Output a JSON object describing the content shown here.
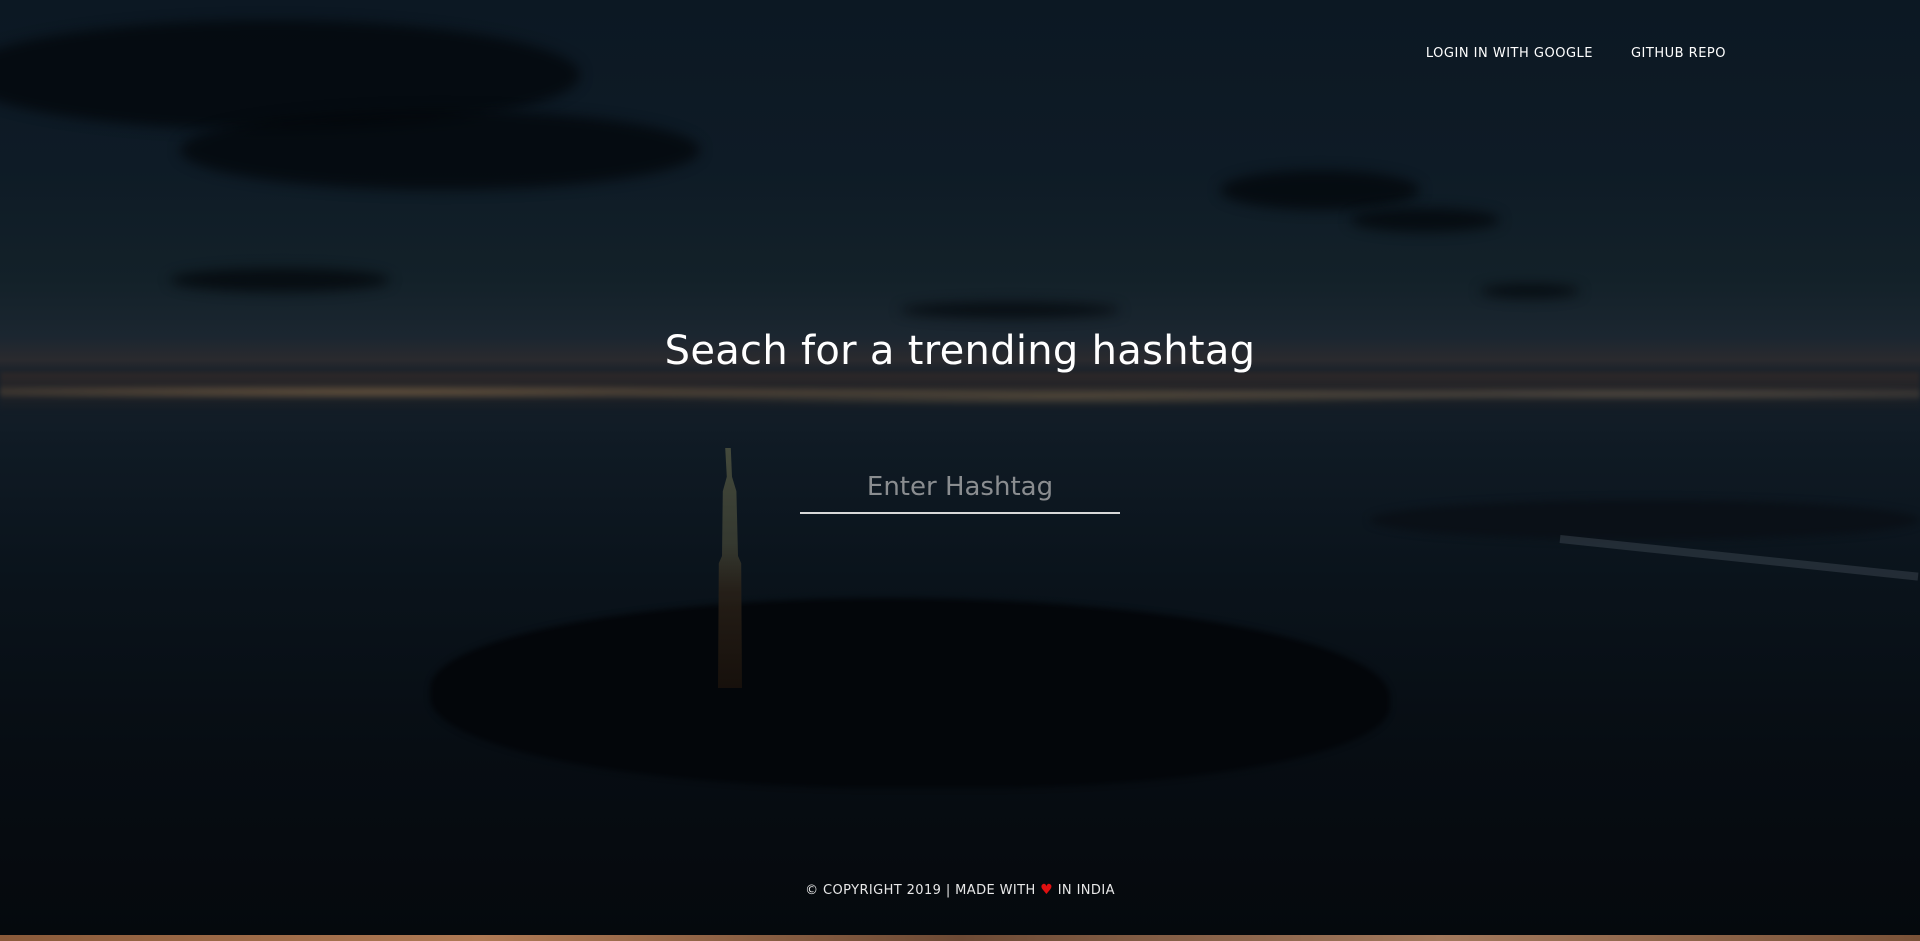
{
  "nav": {
    "login_label": "LOGIN IN WITH GOOGLE",
    "github_label": "GITHUB REPO"
  },
  "hero": {
    "title": "Seach for a trending hashtag"
  },
  "search": {
    "placeholder": "Enter Hashtag",
    "value": ""
  },
  "footer": {
    "text_before": "© COPYRIGHT 2019 | MADE WITH",
    "heart_icon": "heart-icon",
    "text_after": "IN INDIA"
  },
  "colors": {
    "heart": "#e01010",
    "text": "#ffffff",
    "input_underline": "#d8d8d8"
  }
}
